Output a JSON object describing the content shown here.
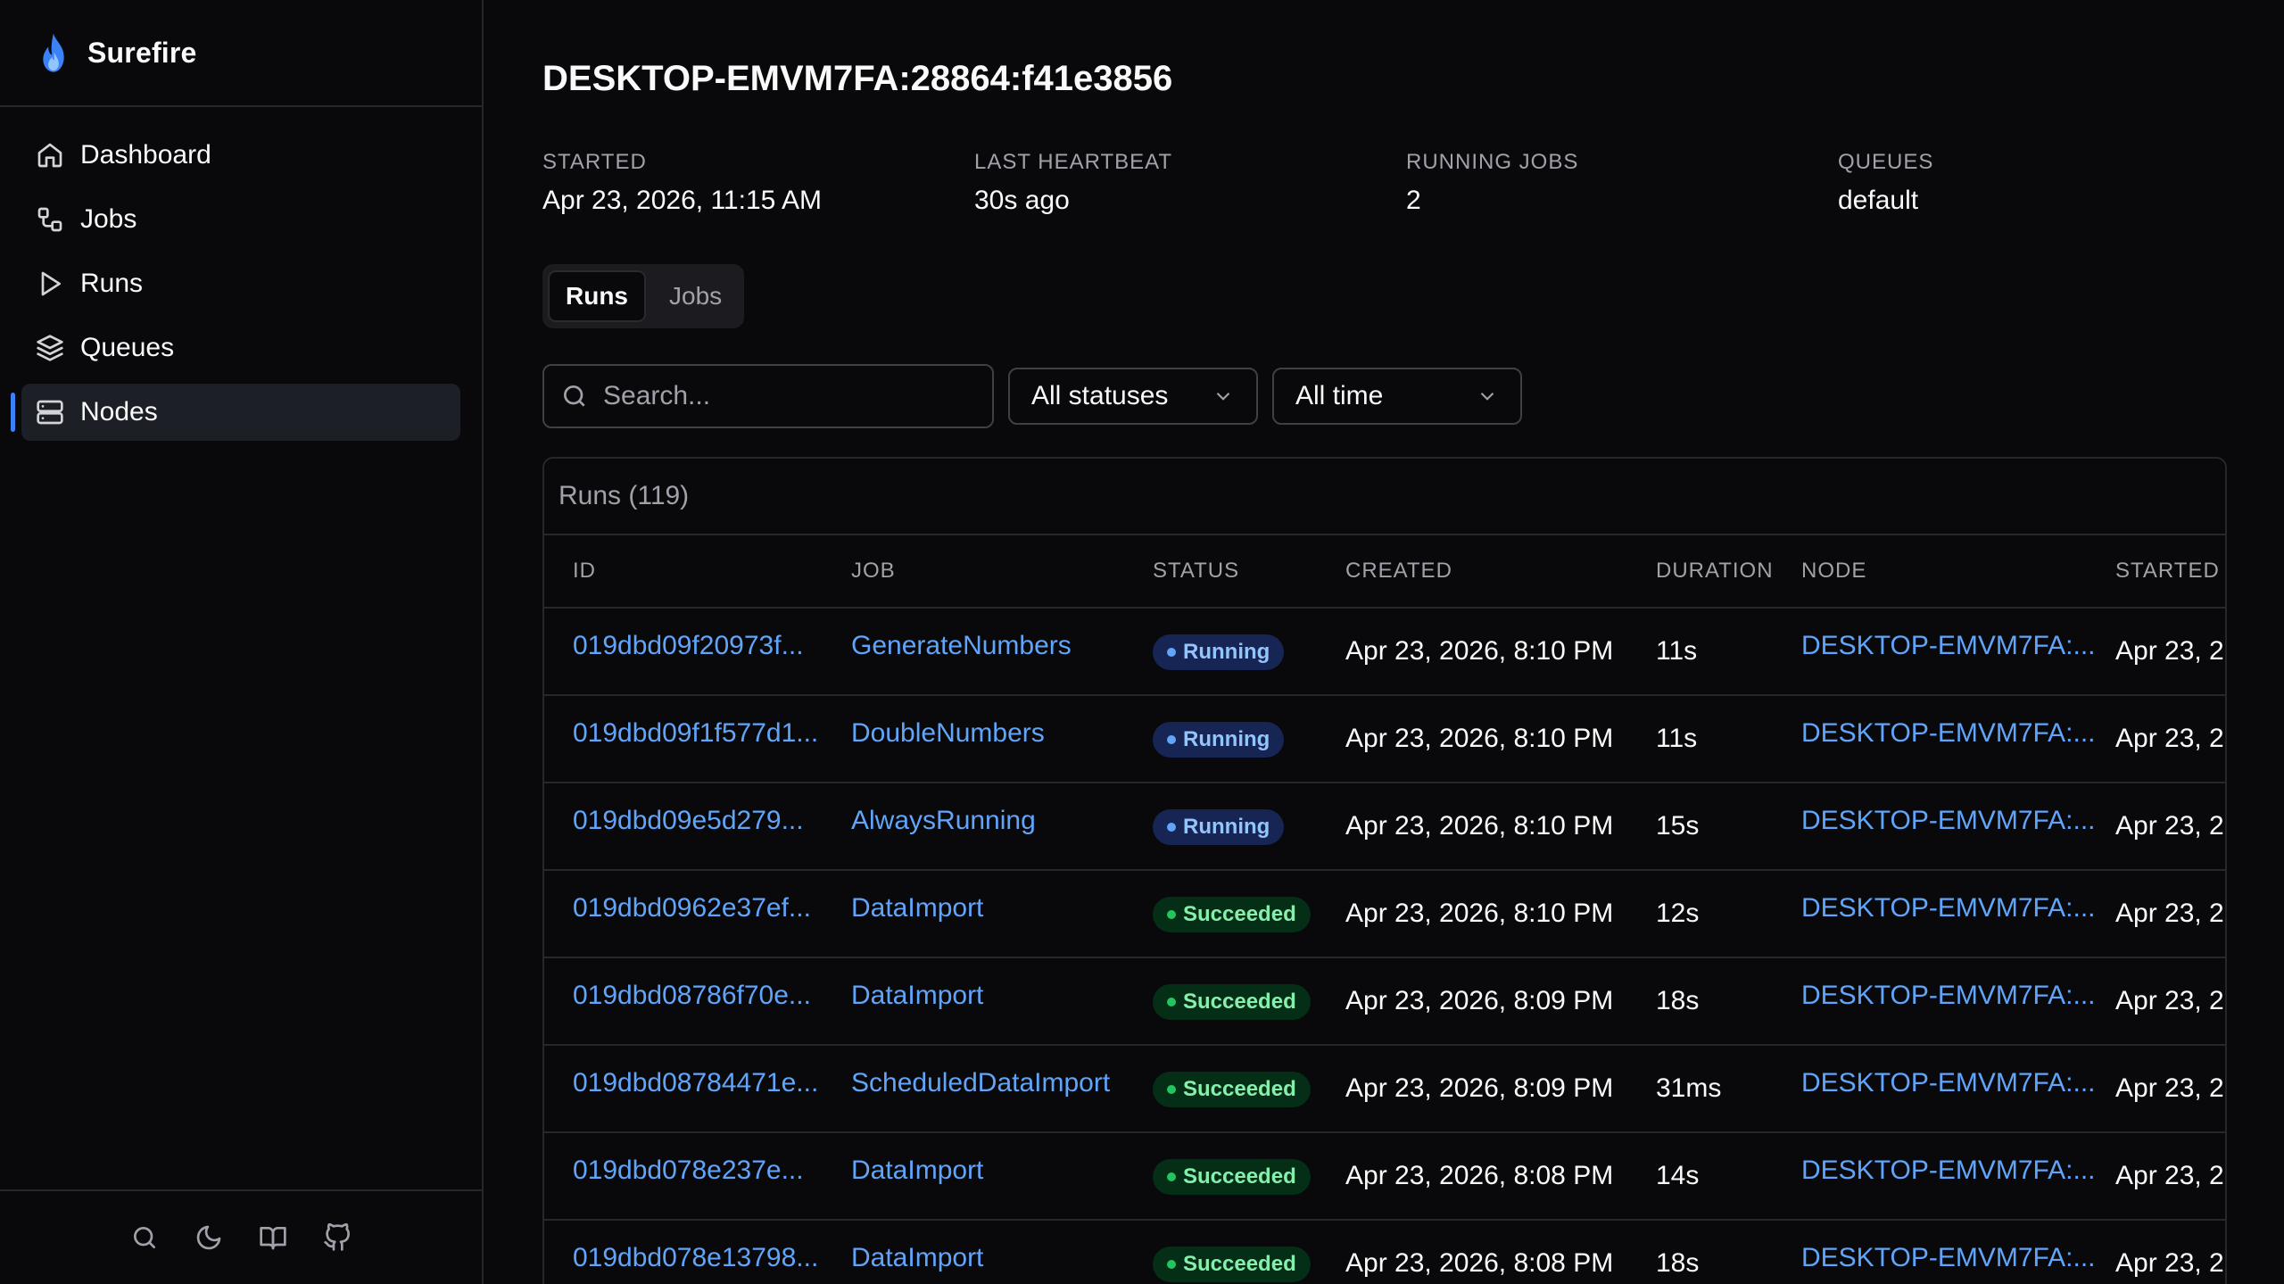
{
  "app": {
    "name": "Surefire"
  },
  "sidebar": {
    "items": [
      {
        "label": "Dashboard",
        "icon": "home-icon",
        "active": false
      },
      {
        "label": "Jobs",
        "icon": "workflow-icon",
        "active": false
      },
      {
        "label": "Runs",
        "icon": "play-icon",
        "active": false
      },
      {
        "label": "Queues",
        "icon": "layers-icon",
        "active": false
      },
      {
        "label": "Nodes",
        "icon": "server-icon",
        "active": true
      }
    ],
    "footer_icons": [
      "search-icon",
      "moon-icon",
      "book-icon",
      "github-icon"
    ]
  },
  "page": {
    "title": "DESKTOP-EMVM7FA:28864:f41e3856",
    "stats": [
      {
        "label": "STARTED",
        "value": "Apr 23, 2026, 11:15 AM"
      },
      {
        "label": "LAST HEARTBEAT",
        "value": "30s ago"
      },
      {
        "label": "RUNNING JOBS",
        "value": "2"
      },
      {
        "label": "QUEUES",
        "value": "default"
      }
    ],
    "tabs": [
      {
        "label": "Runs",
        "active": true
      },
      {
        "label": "Jobs",
        "active": false
      }
    ]
  },
  "filters": {
    "search_placeholder": "Search...",
    "status": "All statuses",
    "time": "All time"
  },
  "table": {
    "title": "Runs (119)",
    "columns": [
      "ID",
      "JOB",
      "STATUS",
      "CREATED",
      "DURATION",
      "NODE",
      "STARTED"
    ],
    "rows": [
      {
        "id": "019dbd09f20973f...",
        "job": "GenerateNumbers",
        "status": "Running",
        "created": "Apr 23, 2026, 8:10 PM",
        "duration": "11s",
        "node": "DESKTOP-EMVM7FA:...",
        "started": "Apr 23, 2"
      },
      {
        "id": "019dbd09f1f577d1...",
        "job": "DoubleNumbers",
        "status": "Running",
        "created": "Apr 23, 2026, 8:10 PM",
        "duration": "11s",
        "node": "DESKTOP-EMVM7FA:...",
        "started": "Apr 23, 2"
      },
      {
        "id": "019dbd09e5d279...",
        "job": "AlwaysRunning",
        "status": "Running",
        "created": "Apr 23, 2026, 8:10 PM",
        "duration": "15s",
        "node": "DESKTOP-EMVM7FA:...",
        "started": "Apr 23, 2"
      },
      {
        "id": "019dbd0962e37ef...",
        "job": "DataImport",
        "status": "Succeeded",
        "created": "Apr 23, 2026, 8:10 PM",
        "duration": "12s",
        "node": "DESKTOP-EMVM7FA:...",
        "started": "Apr 23, 2"
      },
      {
        "id": "019dbd08786f70e...",
        "job": "DataImport",
        "status": "Succeeded",
        "created": "Apr 23, 2026, 8:09 PM",
        "duration": "18s",
        "node": "DESKTOP-EMVM7FA:...",
        "started": "Apr 23, 2"
      },
      {
        "id": "019dbd08784471e...",
        "job": "ScheduledDataImport",
        "status": "Succeeded",
        "created": "Apr 23, 2026, 8:09 PM",
        "duration": "31ms",
        "node": "DESKTOP-EMVM7FA:...",
        "started": "Apr 23, 2"
      },
      {
        "id": "019dbd078e237e...",
        "job": "DataImport",
        "status": "Succeeded",
        "created": "Apr 23, 2026, 8:08 PM",
        "duration": "14s",
        "node": "DESKTOP-EMVM7FA:...",
        "started": "Apr 23, 2"
      },
      {
        "id": "019dbd078e13798...",
        "job": "DataImport",
        "status": "Succeeded",
        "created": "Apr 23, 2026, 8:08 PM",
        "duration": "18s",
        "node": "DESKTOP-EMVM7FA:...",
        "started": "Apr 23, 2"
      }
    ]
  },
  "colors": {
    "background": "#09090b",
    "accent": "#3b82f6",
    "link": "#60a5fa",
    "running_badge": "#172554",
    "succeeded_badge": "#052e16"
  }
}
